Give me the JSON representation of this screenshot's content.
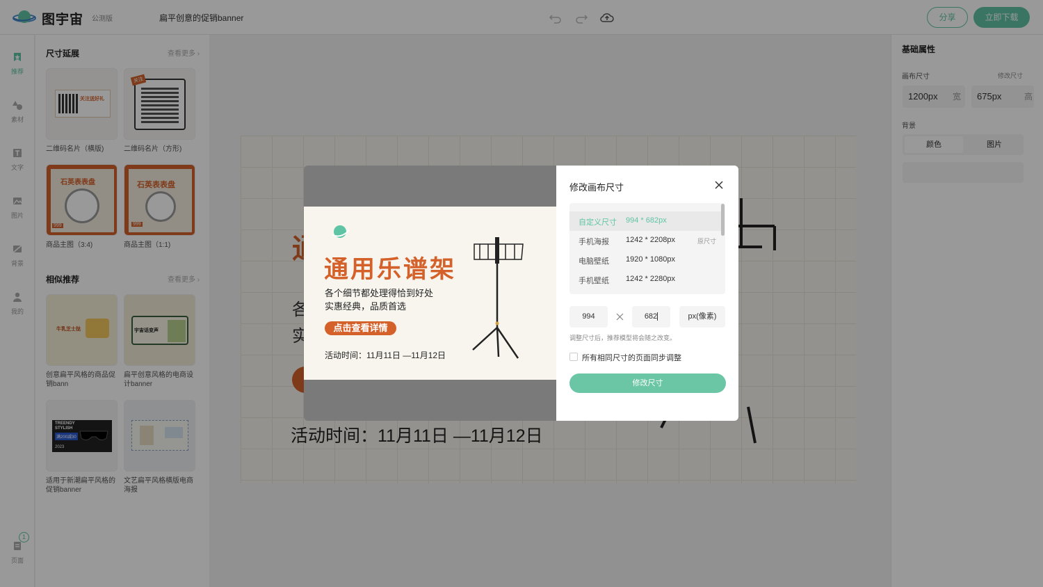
{
  "topbar": {
    "logo_text": "图宇宙",
    "beta_tag": "公测版",
    "doc_title": "扁平创意的促销banner",
    "share_label": "分享",
    "download_label": "立即下载"
  },
  "rail": {
    "items": [
      "推荐",
      "素材",
      "文字",
      "图片",
      "背景",
      "我的"
    ],
    "pages_label": "页面",
    "pages_count": "1"
  },
  "left_panel": {
    "size_ext_title": "尺寸延展",
    "size_ext_more": "查看更多",
    "size_items": [
      {
        "caption": "二维码名片（横版)",
        "line1": "关注送好礼"
      },
      {
        "caption": "二维码名片（方形)",
        "line1": "关注"
      },
      {
        "caption": "商品主图（3:4)",
        "line1": "石英表表盘",
        "price": "999"
      },
      {
        "caption": "商品主图（1:1)",
        "line1": "石英表表盘",
        "price": "999"
      }
    ],
    "similar_title": "相似推荐",
    "similar_more": "查看更多",
    "similar_items": [
      {
        "caption": "创意扁平风格的商品促销bann",
        "line1": "牛乳芝士挞"
      },
      {
        "caption": "扁平创意风格的电商设计banner",
        "line1": "宇宙话变声"
      },
      {
        "caption": "适用于新潮扁平风格的促销banner",
        "line1": "TREENDY",
        "line2": "STYLISH",
        "line3": "满200减30",
        "line4": "2023"
      },
      {
        "caption": "文艺扁平风格横版电商海报",
        "line1": ""
      }
    ]
  },
  "canvas": {
    "bottom_text": "活动时间：11月11日 —11月12日"
  },
  "right_panel": {
    "title": "基础属性",
    "canvas_size_label": "画布尺寸",
    "change_size_label": "修改尺寸",
    "width_value": "1200px",
    "width_unit": "宽",
    "height_value": "675px",
    "height_unit": "高",
    "bg_label": "背景",
    "bg_color_tab": "颜色",
    "bg_image_tab": "图片"
  },
  "banner": {
    "title": "通用乐谱架",
    "line1": "各个细节都处理得恰到好处",
    "line2": "实惠经典，品质首选",
    "cta": "点击查看详情",
    "date": "活动时间：11月11日 —11月12日"
  },
  "dialog": {
    "title": "修改画布尺寸",
    "presets": [
      {
        "name": "自定义尺寸",
        "value": "994 * 682px",
        "tag": ""
      },
      {
        "name": "手机海报",
        "value": "1242 * 2208px",
        "tag": "原尺寸"
      },
      {
        "name": "电脑壁纸",
        "value": "1920 * 1080px",
        "tag": ""
      },
      {
        "name": "手机壁纸",
        "value": "1242 * 2280px",
        "tag": ""
      }
    ],
    "width_input": "994",
    "height_input": "682",
    "unit_select": "px(像素)",
    "hint": "调整尺寸后，推荐模型将会随之改变。",
    "sync_label": "所有相同尺寸的页面同步调整",
    "submit_label": "修改尺寸"
  },
  "colors": {
    "accent": "#5fc4a4",
    "banner_orange": "#d4612a"
  }
}
